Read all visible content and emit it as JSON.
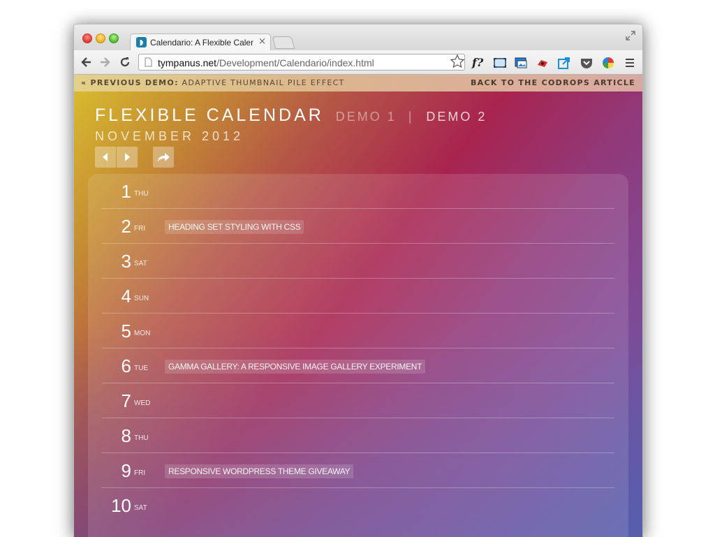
{
  "browser": {
    "tab_title": "Calendario: A Flexible Calendar",
    "tab_close": "×",
    "favicon_glyph": "◗",
    "url_host": "tympanus.net",
    "url_path": "/Development/Calendario/index.html",
    "font_ext_label": "f?"
  },
  "demo_bar": {
    "prev_label": "« Previous Demo:",
    "prev_link": " Adaptive Thumbnail Pile Effect",
    "back_link": "Back to the Codrops Article"
  },
  "header": {
    "title": "FLEXIBLE CALENDAR",
    "demo1": "DEMO 1",
    "separator": "|",
    "demo2": "DEMO 2",
    "month": "NOVEMBER 2012"
  },
  "controls": {
    "prev": "previous-month",
    "next": "next-month",
    "today": "go-to-today"
  },
  "days": [
    {
      "num": "1",
      "name": "THU",
      "event": ""
    },
    {
      "num": "2",
      "name": "FRI",
      "event": "HEADING SET STYLING WITH CSS"
    },
    {
      "num": "3",
      "name": "SAT",
      "event": ""
    },
    {
      "num": "4",
      "name": "SUN",
      "event": ""
    },
    {
      "num": "5",
      "name": "MON",
      "event": ""
    },
    {
      "num": "6",
      "name": "TUE",
      "event": "GAMMA GALLERY: A RESPONSIVE IMAGE GALLERY EXPERIMENT"
    },
    {
      "num": "7",
      "name": "WED",
      "event": ""
    },
    {
      "num": "8",
      "name": "THU",
      "event": ""
    },
    {
      "num": "9",
      "name": "FRI",
      "event": "RESPONSIVE WORDPRESS THEME GIVEAWAY"
    },
    {
      "num": "10",
      "name": "SAT",
      "event": ""
    }
  ],
  "colors": {
    "gradient_start": "#d9be2e",
    "gradient_mid": "#a8244f",
    "gradient_end": "#5a62b0"
  }
}
